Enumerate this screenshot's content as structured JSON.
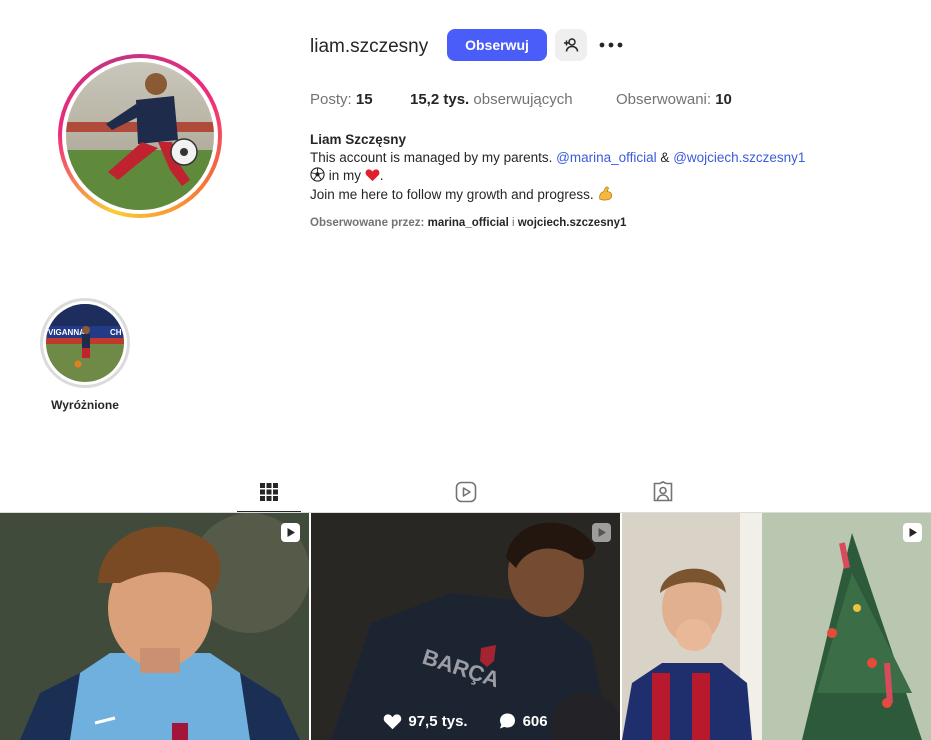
{
  "profile": {
    "username": "liam.szczesny",
    "follow_label": "Obserwuj",
    "stats": {
      "posts_label": "Posty:",
      "posts_value": "15",
      "followers_value": "15,2 tys.",
      "followers_label": "obserwujących",
      "following_label": "Obserwowani:",
      "following_value": "10"
    },
    "bio": {
      "full_name": "Liam Szczęsny",
      "line1_text": "This account is managed by my parents.",
      "mention1": "@marina_official",
      "amp": "&",
      "mention2": "@wojciech.szczesny1",
      "line2_text": "in my",
      "line2_end": ".",
      "line3_text": "Join me here to follow my growth and progress."
    },
    "followed_by": {
      "prefix": "Obserwowane przez:",
      "account1": "marina_official",
      "joiner": "i",
      "account2": "wojciech.szczesny1"
    }
  },
  "highlights": [
    {
      "label": "Wyróżnione"
    }
  ],
  "tabs": [
    {
      "icon": "grid-icon",
      "active": true
    },
    {
      "icon": "reels-icon",
      "active": false
    },
    {
      "icon": "tagged-icon",
      "active": false
    }
  ],
  "posts": [
    {
      "type": "reel",
      "icon": "reel-icon"
    },
    {
      "type": "reel",
      "icon": "reel-icon",
      "likes": "97,5 tys.",
      "comments": "606"
    },
    {
      "type": "reel",
      "icon": "reel-icon"
    }
  ],
  "colors": {
    "accent": "#4a5df9",
    "link": "#3b5bdb",
    "muted": "#737373",
    "divider": "#dbdbdb"
  }
}
